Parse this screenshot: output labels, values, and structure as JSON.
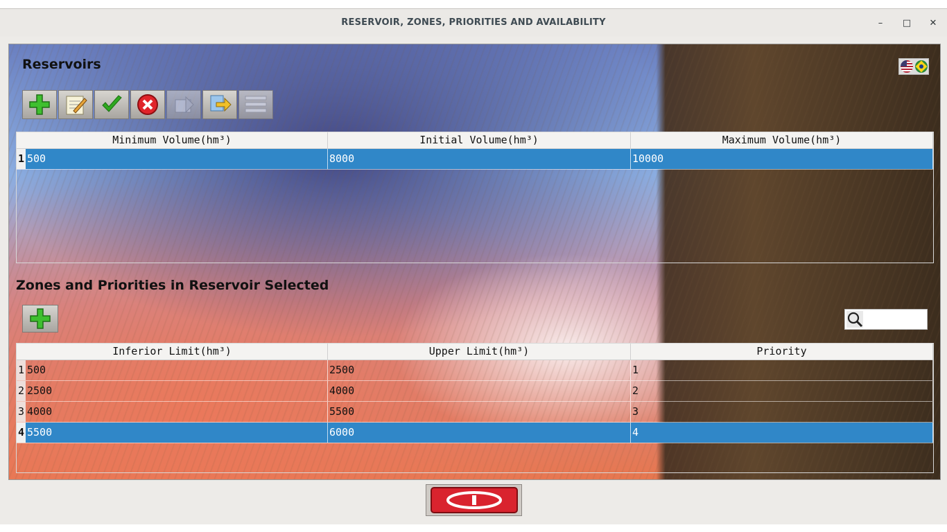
{
  "window": {
    "title": "RESERVOIR, ZONES, PRIORITIES AND AVAILABILITY",
    "controls": {
      "minimize": "–",
      "maximize": "□",
      "close": "✕"
    }
  },
  "reservoirs": {
    "title": "Reservoirs",
    "toolbar": [
      {
        "icon": "add-icon"
      },
      {
        "icon": "edit-icon"
      },
      {
        "icon": "confirm-icon"
      },
      {
        "icon": "cancel-icon"
      },
      {
        "icon": "print-icon"
      },
      {
        "icon": "export-icon"
      },
      {
        "icon": "list-icon"
      }
    ],
    "columns": [
      "Minimum Volume(hm³)",
      "Initial Volume(hm³)",
      "Maximum Volume(hm³)"
    ],
    "rows": [
      {
        "num": "1",
        "cells": [
          "500",
          "8000",
          "10000"
        ],
        "selected": true
      }
    ]
  },
  "zones": {
    "title": "Zones and Priorities in Reservoir Selected",
    "add_icon": "add-icon",
    "search": {
      "value": "",
      "placeholder": ""
    },
    "columns": [
      "Inferior Limit(hm³)",
      "Upper Limit(hm³)",
      "Priority"
    ],
    "rows": [
      {
        "num": "1",
        "cells": [
          "500",
          "2500",
          "1"
        ],
        "selected": false
      },
      {
        "num": "2",
        "cells": [
          "2500",
          "4000",
          "2"
        ],
        "selected": false
      },
      {
        "num": "3",
        "cells": [
          "4000",
          "5500",
          "3"
        ],
        "selected": false
      },
      {
        "num": "4",
        "cells": [
          "5500",
          "6000",
          "4"
        ],
        "selected": true
      }
    ]
  },
  "language_flags": [
    "us-flag-icon",
    "brazil-flag-icon"
  ],
  "colors": {
    "selection": "#3087c8",
    "exit_button": "#d9232e"
  }
}
